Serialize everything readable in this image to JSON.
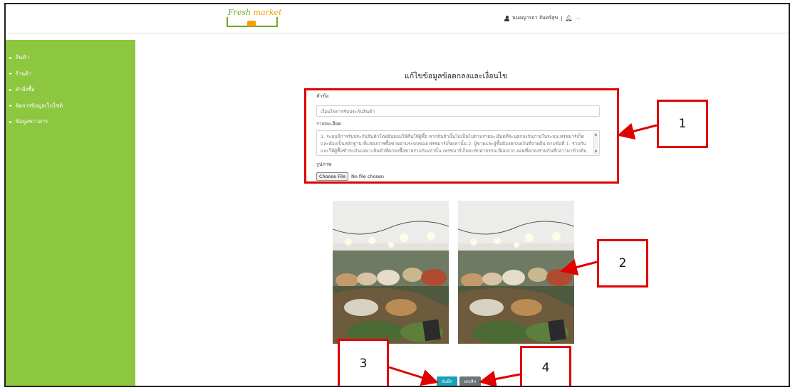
{
  "header": {
    "logo_text_a": "Fresh",
    "logo_text_b": "market",
    "user_name": "นนอญารถา จันทร์สุข",
    "separator": "|",
    "more": "⋯"
  },
  "sidebar": {
    "items": [
      {
        "label": "สินค้า"
      },
      {
        "label": "ร้านค้า"
      },
      {
        "label": "คำสั่งซื้อ"
      },
      {
        "label": "จัดการข้อมูลเว็บไซต์"
      },
      {
        "label": "ข้อมูลข่าวสาร"
      }
    ]
  },
  "main": {
    "title": "แก้ไขข้อมูลข้อตกลงและเงื่อนไข",
    "topic_label": "หัวข้อ",
    "topic_value": "เงื่อนไขการรับประกันสินค้า",
    "detail_label": "รายละเอียด",
    "detail_value": "1. ระบบมีการรับประกันสินค้าโดยยินยอมให้คืนให้ผู้ซื้อ หากสินค้านั้นไม่เป็นไปตามรายละเอียดที่ระบุตกลงกันภายในระบบเฟรชมาร์เก็ต และต้องเป็นหลักฐาน ที่แสดงการซื้อขายผ่านระบบของเฟรชมาร์เก็ตเท่านั้น 2. ผู้ขายและผู้ซื้อต้องตกลงเงินที่จ่ายคืน ตามข้อที่ 1. ร่วมกันและให้ผู้ซื้อชำระเงินเฉพาะสินค้าที่ตกลงซื้อขายร่วมกันเท่านั้น เฟรชมาร์เก็ตจะหักค่าธรรมเนียมจาก ยอดที่ตกลงร่วมกันที่กล่าวมาข้างต้น และ",
    "image_label": "รูปภาพ",
    "file_button": "Choose File",
    "file_status": "No file chosen"
  },
  "buttons": {
    "save": "บันทึก",
    "cancel": "ยกเลิก"
  },
  "annotations": {
    "n1": "1",
    "n2": "2",
    "n3": "3",
    "n4": "4"
  },
  "colors": {
    "sidebar_bg": "#8dc63f",
    "save_btn": "#17a2b8",
    "cancel_btn": "#6c757d",
    "annotation_red": "#e00000"
  }
}
